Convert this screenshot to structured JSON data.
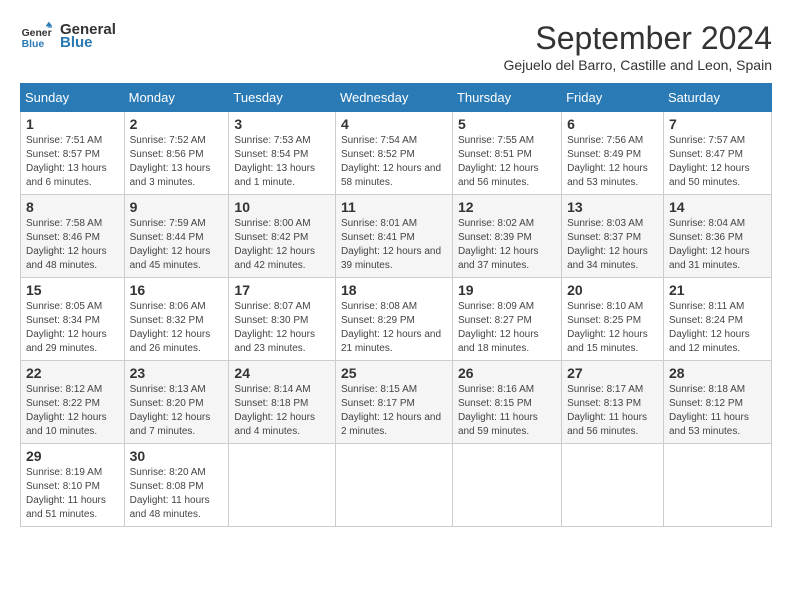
{
  "header": {
    "logo_line1": "General",
    "logo_line2": "Blue",
    "month_title": "September 2024",
    "location": "Gejuelo del Barro, Castille and Leon, Spain"
  },
  "weekdays": [
    "Sunday",
    "Monday",
    "Tuesday",
    "Wednesday",
    "Thursday",
    "Friday",
    "Saturday"
  ],
  "weeks": [
    [
      {
        "day": "1",
        "sunrise": "7:51 AM",
        "sunset": "8:57 PM",
        "daylight": "13 hours and 6 minutes."
      },
      {
        "day": "2",
        "sunrise": "7:52 AM",
        "sunset": "8:56 PM",
        "daylight": "13 hours and 3 minutes."
      },
      {
        "day": "3",
        "sunrise": "7:53 AM",
        "sunset": "8:54 PM",
        "daylight": "13 hours and 1 minute."
      },
      {
        "day": "4",
        "sunrise": "7:54 AM",
        "sunset": "8:52 PM",
        "daylight": "12 hours and 58 minutes."
      },
      {
        "day": "5",
        "sunrise": "7:55 AM",
        "sunset": "8:51 PM",
        "daylight": "12 hours and 56 minutes."
      },
      {
        "day": "6",
        "sunrise": "7:56 AM",
        "sunset": "8:49 PM",
        "daylight": "12 hours and 53 minutes."
      },
      {
        "day": "7",
        "sunrise": "7:57 AM",
        "sunset": "8:47 PM",
        "daylight": "12 hours and 50 minutes."
      }
    ],
    [
      {
        "day": "8",
        "sunrise": "7:58 AM",
        "sunset": "8:46 PM",
        "daylight": "12 hours and 48 minutes."
      },
      {
        "day": "9",
        "sunrise": "7:59 AM",
        "sunset": "8:44 PM",
        "daylight": "12 hours and 45 minutes."
      },
      {
        "day": "10",
        "sunrise": "8:00 AM",
        "sunset": "8:42 PM",
        "daylight": "12 hours and 42 minutes."
      },
      {
        "day": "11",
        "sunrise": "8:01 AM",
        "sunset": "8:41 PM",
        "daylight": "12 hours and 39 minutes."
      },
      {
        "day": "12",
        "sunrise": "8:02 AM",
        "sunset": "8:39 PM",
        "daylight": "12 hours and 37 minutes."
      },
      {
        "day": "13",
        "sunrise": "8:03 AM",
        "sunset": "8:37 PM",
        "daylight": "12 hours and 34 minutes."
      },
      {
        "day": "14",
        "sunrise": "8:04 AM",
        "sunset": "8:36 PM",
        "daylight": "12 hours and 31 minutes."
      }
    ],
    [
      {
        "day": "15",
        "sunrise": "8:05 AM",
        "sunset": "8:34 PM",
        "daylight": "12 hours and 29 minutes."
      },
      {
        "day": "16",
        "sunrise": "8:06 AM",
        "sunset": "8:32 PM",
        "daylight": "12 hours and 26 minutes."
      },
      {
        "day": "17",
        "sunrise": "8:07 AM",
        "sunset": "8:30 PM",
        "daylight": "12 hours and 23 minutes."
      },
      {
        "day": "18",
        "sunrise": "8:08 AM",
        "sunset": "8:29 PM",
        "daylight": "12 hours and 21 minutes."
      },
      {
        "day": "19",
        "sunrise": "8:09 AM",
        "sunset": "8:27 PM",
        "daylight": "12 hours and 18 minutes."
      },
      {
        "day": "20",
        "sunrise": "8:10 AM",
        "sunset": "8:25 PM",
        "daylight": "12 hours and 15 minutes."
      },
      {
        "day": "21",
        "sunrise": "8:11 AM",
        "sunset": "8:24 PM",
        "daylight": "12 hours and 12 minutes."
      }
    ],
    [
      {
        "day": "22",
        "sunrise": "8:12 AM",
        "sunset": "8:22 PM",
        "daylight": "12 hours and 10 minutes."
      },
      {
        "day": "23",
        "sunrise": "8:13 AM",
        "sunset": "8:20 PM",
        "daylight": "12 hours and 7 minutes."
      },
      {
        "day": "24",
        "sunrise": "8:14 AM",
        "sunset": "8:18 PM",
        "daylight": "12 hours and 4 minutes."
      },
      {
        "day": "25",
        "sunrise": "8:15 AM",
        "sunset": "8:17 PM",
        "daylight": "12 hours and 2 minutes."
      },
      {
        "day": "26",
        "sunrise": "8:16 AM",
        "sunset": "8:15 PM",
        "daylight": "11 hours and 59 minutes."
      },
      {
        "day": "27",
        "sunrise": "8:17 AM",
        "sunset": "8:13 PM",
        "daylight": "11 hours and 56 minutes."
      },
      {
        "day": "28",
        "sunrise": "8:18 AM",
        "sunset": "8:12 PM",
        "daylight": "11 hours and 53 minutes."
      }
    ],
    [
      {
        "day": "29",
        "sunrise": "8:19 AM",
        "sunset": "8:10 PM",
        "daylight": "11 hours and 51 minutes."
      },
      {
        "day": "30",
        "sunrise": "8:20 AM",
        "sunset": "8:08 PM",
        "daylight": "11 hours and 48 minutes."
      },
      null,
      null,
      null,
      null,
      null
    ]
  ],
  "labels": {
    "sunrise": "Sunrise:",
    "sunset": "Sunset:",
    "daylight": "Daylight:"
  }
}
